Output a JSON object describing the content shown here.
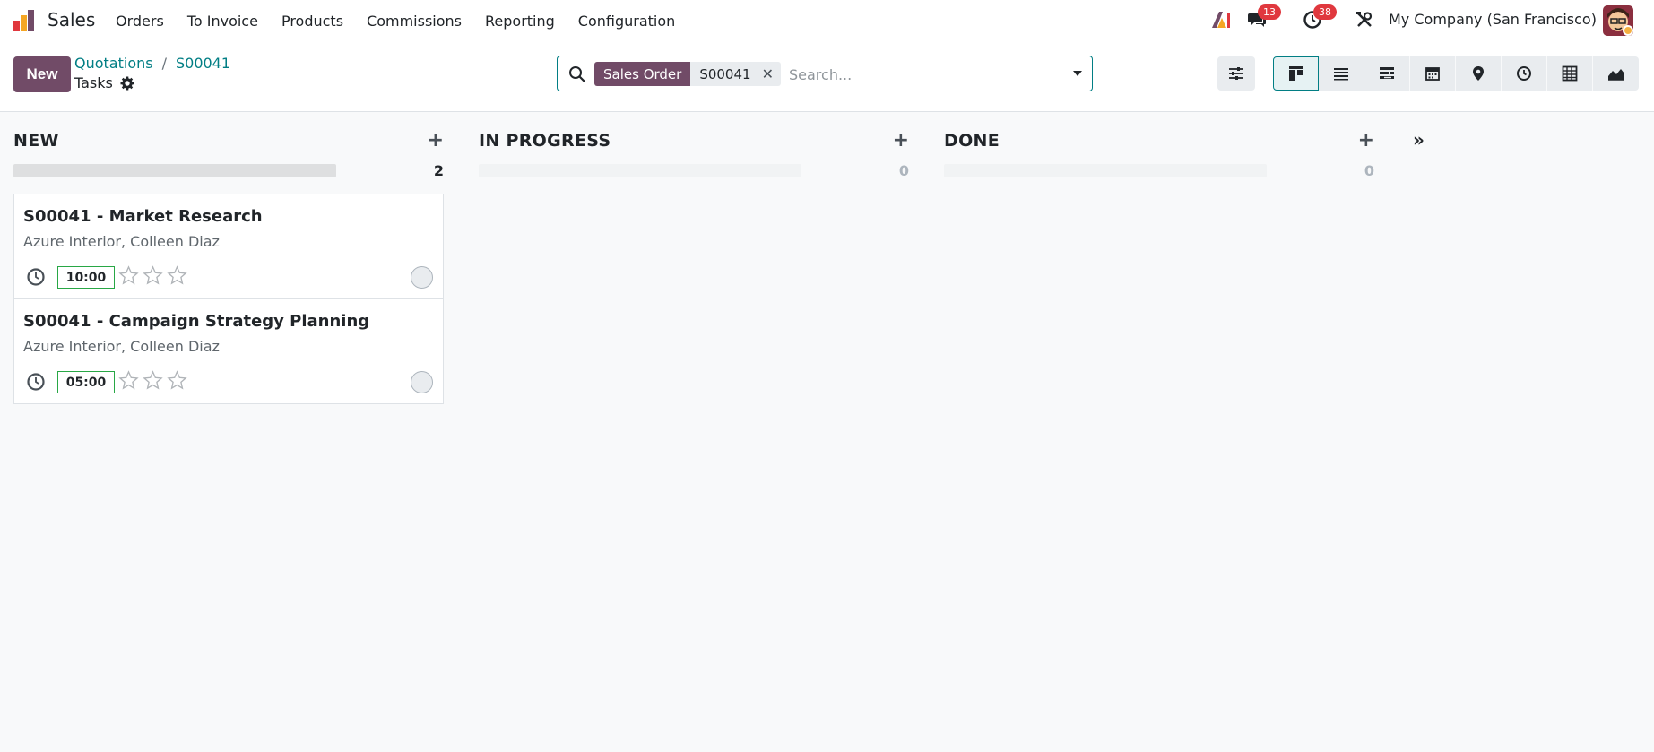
{
  "navbar": {
    "app_name": "Sales",
    "menu": [
      "Orders",
      "To Invoice",
      "Products",
      "Commissions",
      "Reporting",
      "Configuration"
    ],
    "messages_count": "13",
    "activities_count": "38",
    "company": "My Company (San Francisco)"
  },
  "control_panel": {
    "new_label": "New",
    "breadcrumb": [
      "Quotations",
      "S00041"
    ],
    "breadcrumb_sep": "/",
    "title": "Tasks",
    "search": {
      "facet_label": "Sales Order",
      "facet_value": "S00041",
      "facet_remove": "✕",
      "placeholder": "Search..."
    },
    "views": [
      "kanban",
      "list",
      "gantt",
      "calendar",
      "map",
      "activity",
      "pivot",
      "graph"
    ]
  },
  "kanban": {
    "columns": [
      {
        "title": "NEW",
        "count": "2",
        "add": "+",
        "cards": [
          {
            "title": "S00041 - Market Research",
            "customer": "Azure Interior, Colleen Diaz",
            "hours": "10:00",
            "stars": 0
          },
          {
            "title": "S00041 - Campaign Strategy Planning",
            "customer": "Azure Interior, Colleen Diaz",
            "hours": "05:00",
            "stars": 0
          }
        ]
      },
      {
        "title": "IN PROGRESS",
        "count": "0",
        "add": "+",
        "cards": []
      },
      {
        "title": "DONE",
        "count": "0",
        "add": "+",
        "cards": []
      }
    ],
    "fold_label": "»"
  },
  "colors": {
    "brand": "#714b67",
    "link": "#017e84",
    "badge": "#e0383e",
    "hours_border": "#28a745"
  }
}
